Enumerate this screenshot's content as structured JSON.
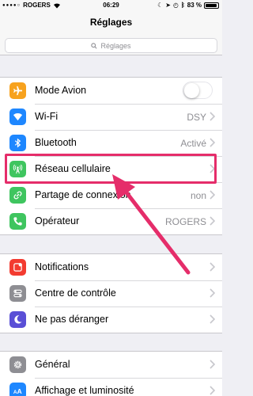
{
  "status_bar": {
    "carrier": "ROGERS",
    "time": "06:29",
    "battery": "83 %",
    "battery_level": 0.83
  },
  "nav": {
    "title": "Réglages"
  },
  "search": {
    "placeholder": "Réglages"
  },
  "groups": [
    {
      "items": [
        {
          "label": "Mode Avion",
          "icon": "airplane-icon",
          "color": "#f7a21e",
          "toggle": false
        },
        {
          "label": "Wi-Fi",
          "icon": "wifi-icon",
          "color": "#1e87ff",
          "value": "DSY"
        },
        {
          "label": "Bluetooth",
          "icon": "bluetooth-icon",
          "color": "#1e87ff",
          "value": "Activé"
        },
        {
          "label": "Réseau cellulaire",
          "icon": "antenna-icon",
          "color": "#3fc55f",
          "value": ""
        },
        {
          "label": "Partage de connexion",
          "icon": "link-icon",
          "color": "#3fc55f",
          "value": "non"
        },
        {
          "label": "Opérateur",
          "icon": "phone-icon",
          "color": "#3fc55f",
          "value": "ROGERS"
        }
      ]
    },
    {
      "items": [
        {
          "label": "Notifications",
          "icon": "notifications-icon",
          "color": "#f33b30"
        },
        {
          "label": "Centre de contrôle",
          "icon": "control-center-icon",
          "color": "#8e8e93"
        },
        {
          "label": "Ne pas déranger",
          "icon": "moon-icon",
          "color": "#5a4fd6"
        }
      ]
    },
    {
      "items": [
        {
          "label": "Général",
          "icon": "gear-icon",
          "color": "#8e8e93"
        },
        {
          "label": "Affichage et luminosité",
          "icon": "text-size-icon",
          "color": "#1e87ff"
        }
      ]
    }
  ],
  "annotation": {
    "color": "#e52d6a"
  }
}
